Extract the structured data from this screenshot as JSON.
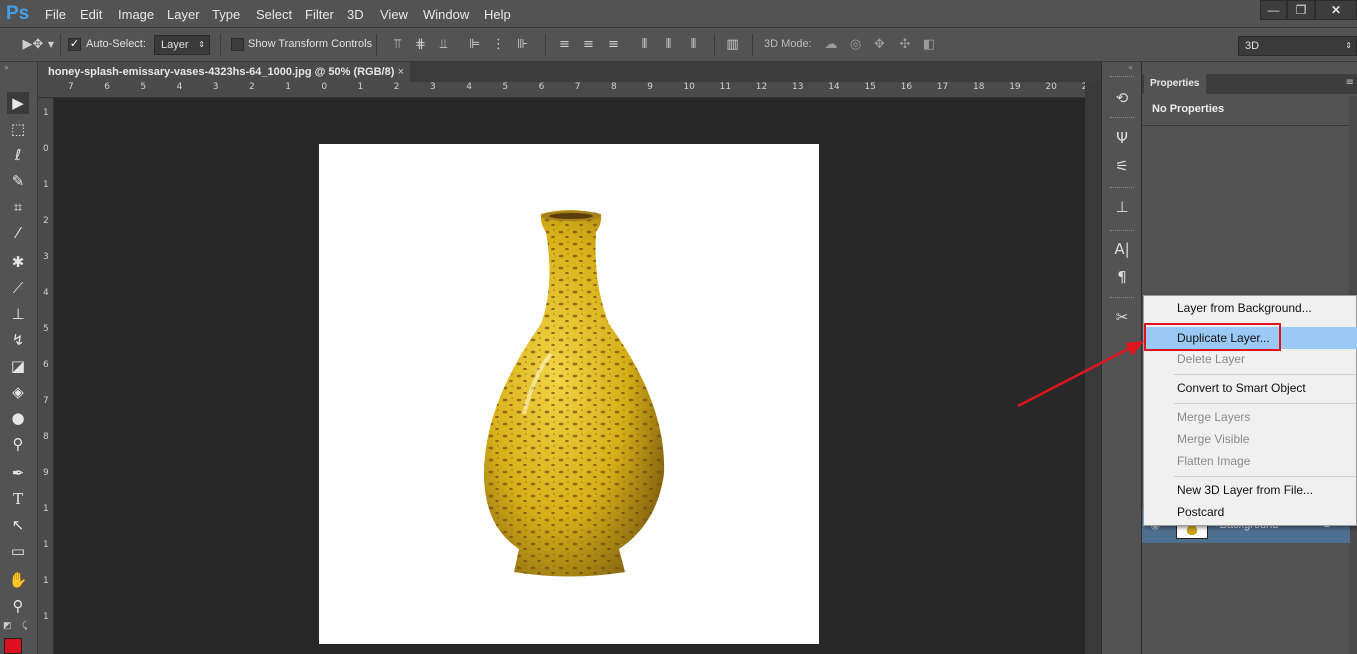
{
  "app": {
    "logo": "Ps",
    "brand_color": "#43a0e8"
  },
  "menubar": {
    "items": [
      "File",
      "Edit",
      "Image",
      "Layer",
      "Type",
      "Select",
      "Filter",
      "3D",
      "View",
      "Window",
      "Help"
    ],
    "window_controls": [
      "minimize-icon",
      "restore-icon",
      "close-icon"
    ]
  },
  "options_bar": {
    "auto_select_label": "Auto-Select:",
    "auto_select_checked": true,
    "auto_select_value": "Layer",
    "transform_controls_label": "Show Transform Controls",
    "transform_controls_checked": false,
    "mode_3d_label": "3D Mode:",
    "workspace_value": "3D"
  },
  "document": {
    "tab_title": "honey-splash-emissary-vases-4323hs-64_1000.jpg @ 50% (RGB/8)",
    "close_glyph": "×",
    "ruler_h": [
      "7",
      "6",
      "5",
      "4",
      "3",
      "2",
      "1",
      "0",
      "1",
      "2",
      "3",
      "4",
      "5",
      "6",
      "7",
      "8",
      "9",
      "10",
      "11",
      "12",
      "13",
      "14",
      "15",
      "16",
      "17",
      "18",
      "19",
      "20",
      "2"
    ],
    "ruler_v": [
      "1",
      "0",
      "1",
      "2",
      "3",
      "4",
      "5",
      "6",
      "7",
      "8",
      "9",
      "1",
      "1",
      "1",
      "1"
    ],
    "image_subject": "yellow-speckled-vase"
  },
  "properties_panel": {
    "tab_label": "Properties",
    "message": "No Properties",
    "layer_name": "Background"
  },
  "context_menu": {
    "items": [
      {
        "label": "Layer from Background...",
        "state": "enabled"
      },
      {
        "label": "Duplicate Layer...",
        "state": "highlighted"
      },
      {
        "label": "Delete Layer",
        "state": "disabled"
      },
      {
        "label": "Convert to Smart Object",
        "state": "enabled"
      },
      {
        "label": "Merge Layers",
        "state": "disabled"
      },
      {
        "label": "Merge Visible",
        "state": "disabled"
      },
      {
        "label": "Flatten Image",
        "state": "disabled"
      },
      {
        "label": "New 3D Layer from File...",
        "state": "enabled"
      },
      {
        "label": "Postcard",
        "state": "enabled"
      }
    ],
    "highlight_color": "#99c9f4"
  },
  "annotation": {
    "arrow_color": "#e0141e",
    "box_color": "#e0141e"
  },
  "colors": {
    "foreground": "#e01020",
    "background": "#ffffff"
  }
}
